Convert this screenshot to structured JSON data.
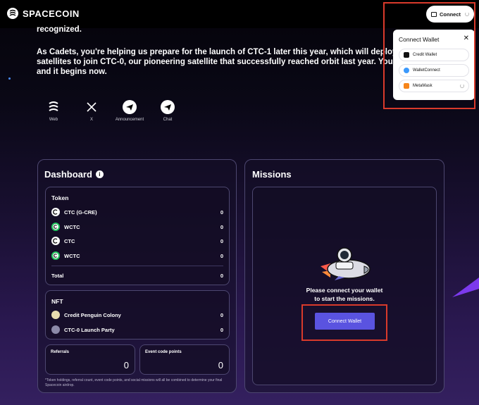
{
  "brand": {
    "name": "SPACECOIN"
  },
  "intro": {
    "line1": "recognized.",
    "line2": "As Cadets, you're helping us prepare for the launch of CTC-1 later this year, which will deploy three",
    "line3": "satellites to join CTC-0, our pioneering satellite that successfully reached orbit last year. Your missi",
    "line4": "and it begins now."
  },
  "socials": [
    {
      "label": "Web",
      "icon": "spacecoin-logo-icon"
    },
    {
      "label": "X",
      "icon": "x-icon"
    },
    {
      "label": "Announcement",
      "icon": "telegram-icon"
    },
    {
      "label": "Chat",
      "icon": "telegram-icon"
    }
  ],
  "header": {
    "connect_label": "Connect"
  },
  "wallet_dropdown": {
    "title": "Connect Wallet",
    "options": [
      {
        "label": "Credit Wallet",
        "icon": "credit-wallet-icon"
      },
      {
        "label": "WalletConnect",
        "icon": "walletconnect-icon"
      },
      {
        "label": "MetaMask",
        "icon": "metamask-icon"
      }
    ]
  },
  "dashboard": {
    "title": "Dashboard",
    "token": {
      "title": "Token",
      "rows": [
        {
          "name": "CTC (G-CRE)",
          "value": "0"
        },
        {
          "name": "WCTC",
          "value": "0"
        },
        {
          "name": "CTC",
          "value": "0"
        },
        {
          "name": "WCTC",
          "value": "0"
        }
      ],
      "total_label": "Total",
      "total_value": "0"
    },
    "nft": {
      "title": "NFT",
      "rows": [
        {
          "name": "Credit Penguin Colony",
          "value": "0"
        },
        {
          "name": "CTC-0 Launch Party",
          "value": "0"
        }
      ]
    },
    "referrals": {
      "label": "Referrals",
      "value": "0"
    },
    "event_points": {
      "label": "Event code points",
      "value": "0"
    },
    "footnote": "*Token holdings, referral count, event code points, and social missions will all be combined to determine your final Spacecoin airdrop."
  },
  "missions": {
    "title": "Missions",
    "message_line1": "Please connect your wallet",
    "message_line2": "to start the missions.",
    "button_label": "Connect Wallet"
  },
  "colors": {
    "accent": "#5a53e0",
    "highlight": "#d93a2b",
    "token_green": "#22c55e"
  }
}
